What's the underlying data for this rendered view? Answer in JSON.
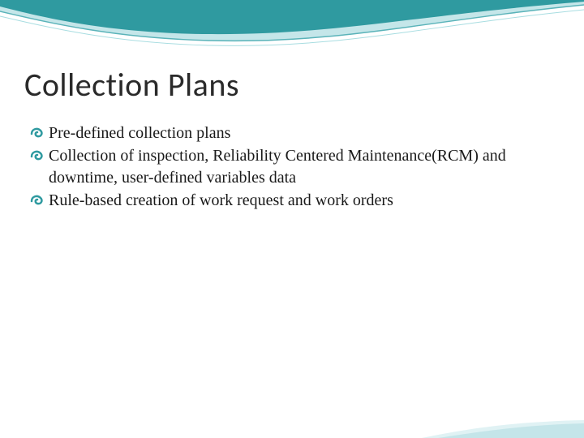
{
  "title": "Collection Plans",
  "bullets": [
    "Pre-defined collection plans",
    "Collection of inspection, Reliability Centered Maintenance(RCM) and downtime, user-defined variables data",
    "Rule-based creation of work request and work orders"
  ],
  "colors": {
    "accent": "#2f9aa0",
    "accent_light": "#8bccd3",
    "title": "#2a2a2a",
    "body": "#1a1a1a"
  }
}
